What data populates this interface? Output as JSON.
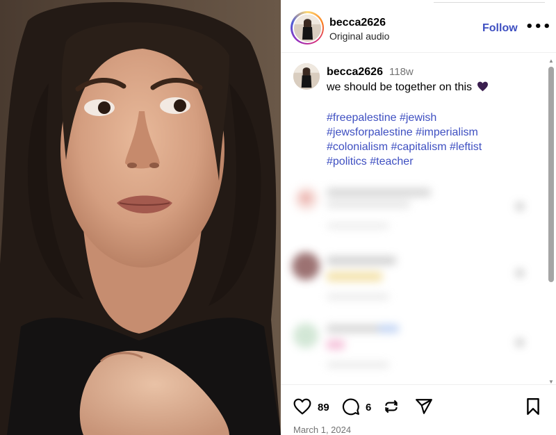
{
  "post": {
    "author": "becca2626",
    "audio": "Original audio",
    "follow_label": "Follow",
    "more_label": "•••",
    "caption_user": "becca2626",
    "caption_time": "118w",
    "caption_text": "we should be together on this",
    "hashtags": [
      "#freepalestine",
      "#jewish",
      "#jewsforpalestine",
      "#imperialism",
      "#colonialism",
      "#capitalism",
      "#leftist",
      "#politics",
      "#teacher"
    ],
    "likes": "89",
    "comments": "6",
    "date": "March 1, 2024"
  },
  "icons": {
    "like": "heart-icon",
    "comment": "comment-icon",
    "repost": "repost-icon",
    "share": "share-icon",
    "save": "bookmark-icon",
    "caption_emoji": "purple-heart-icon"
  },
  "colors": {
    "link": "#3e4fc1",
    "muted": "#737373",
    "emoji_heart": "#3b1f4f"
  }
}
